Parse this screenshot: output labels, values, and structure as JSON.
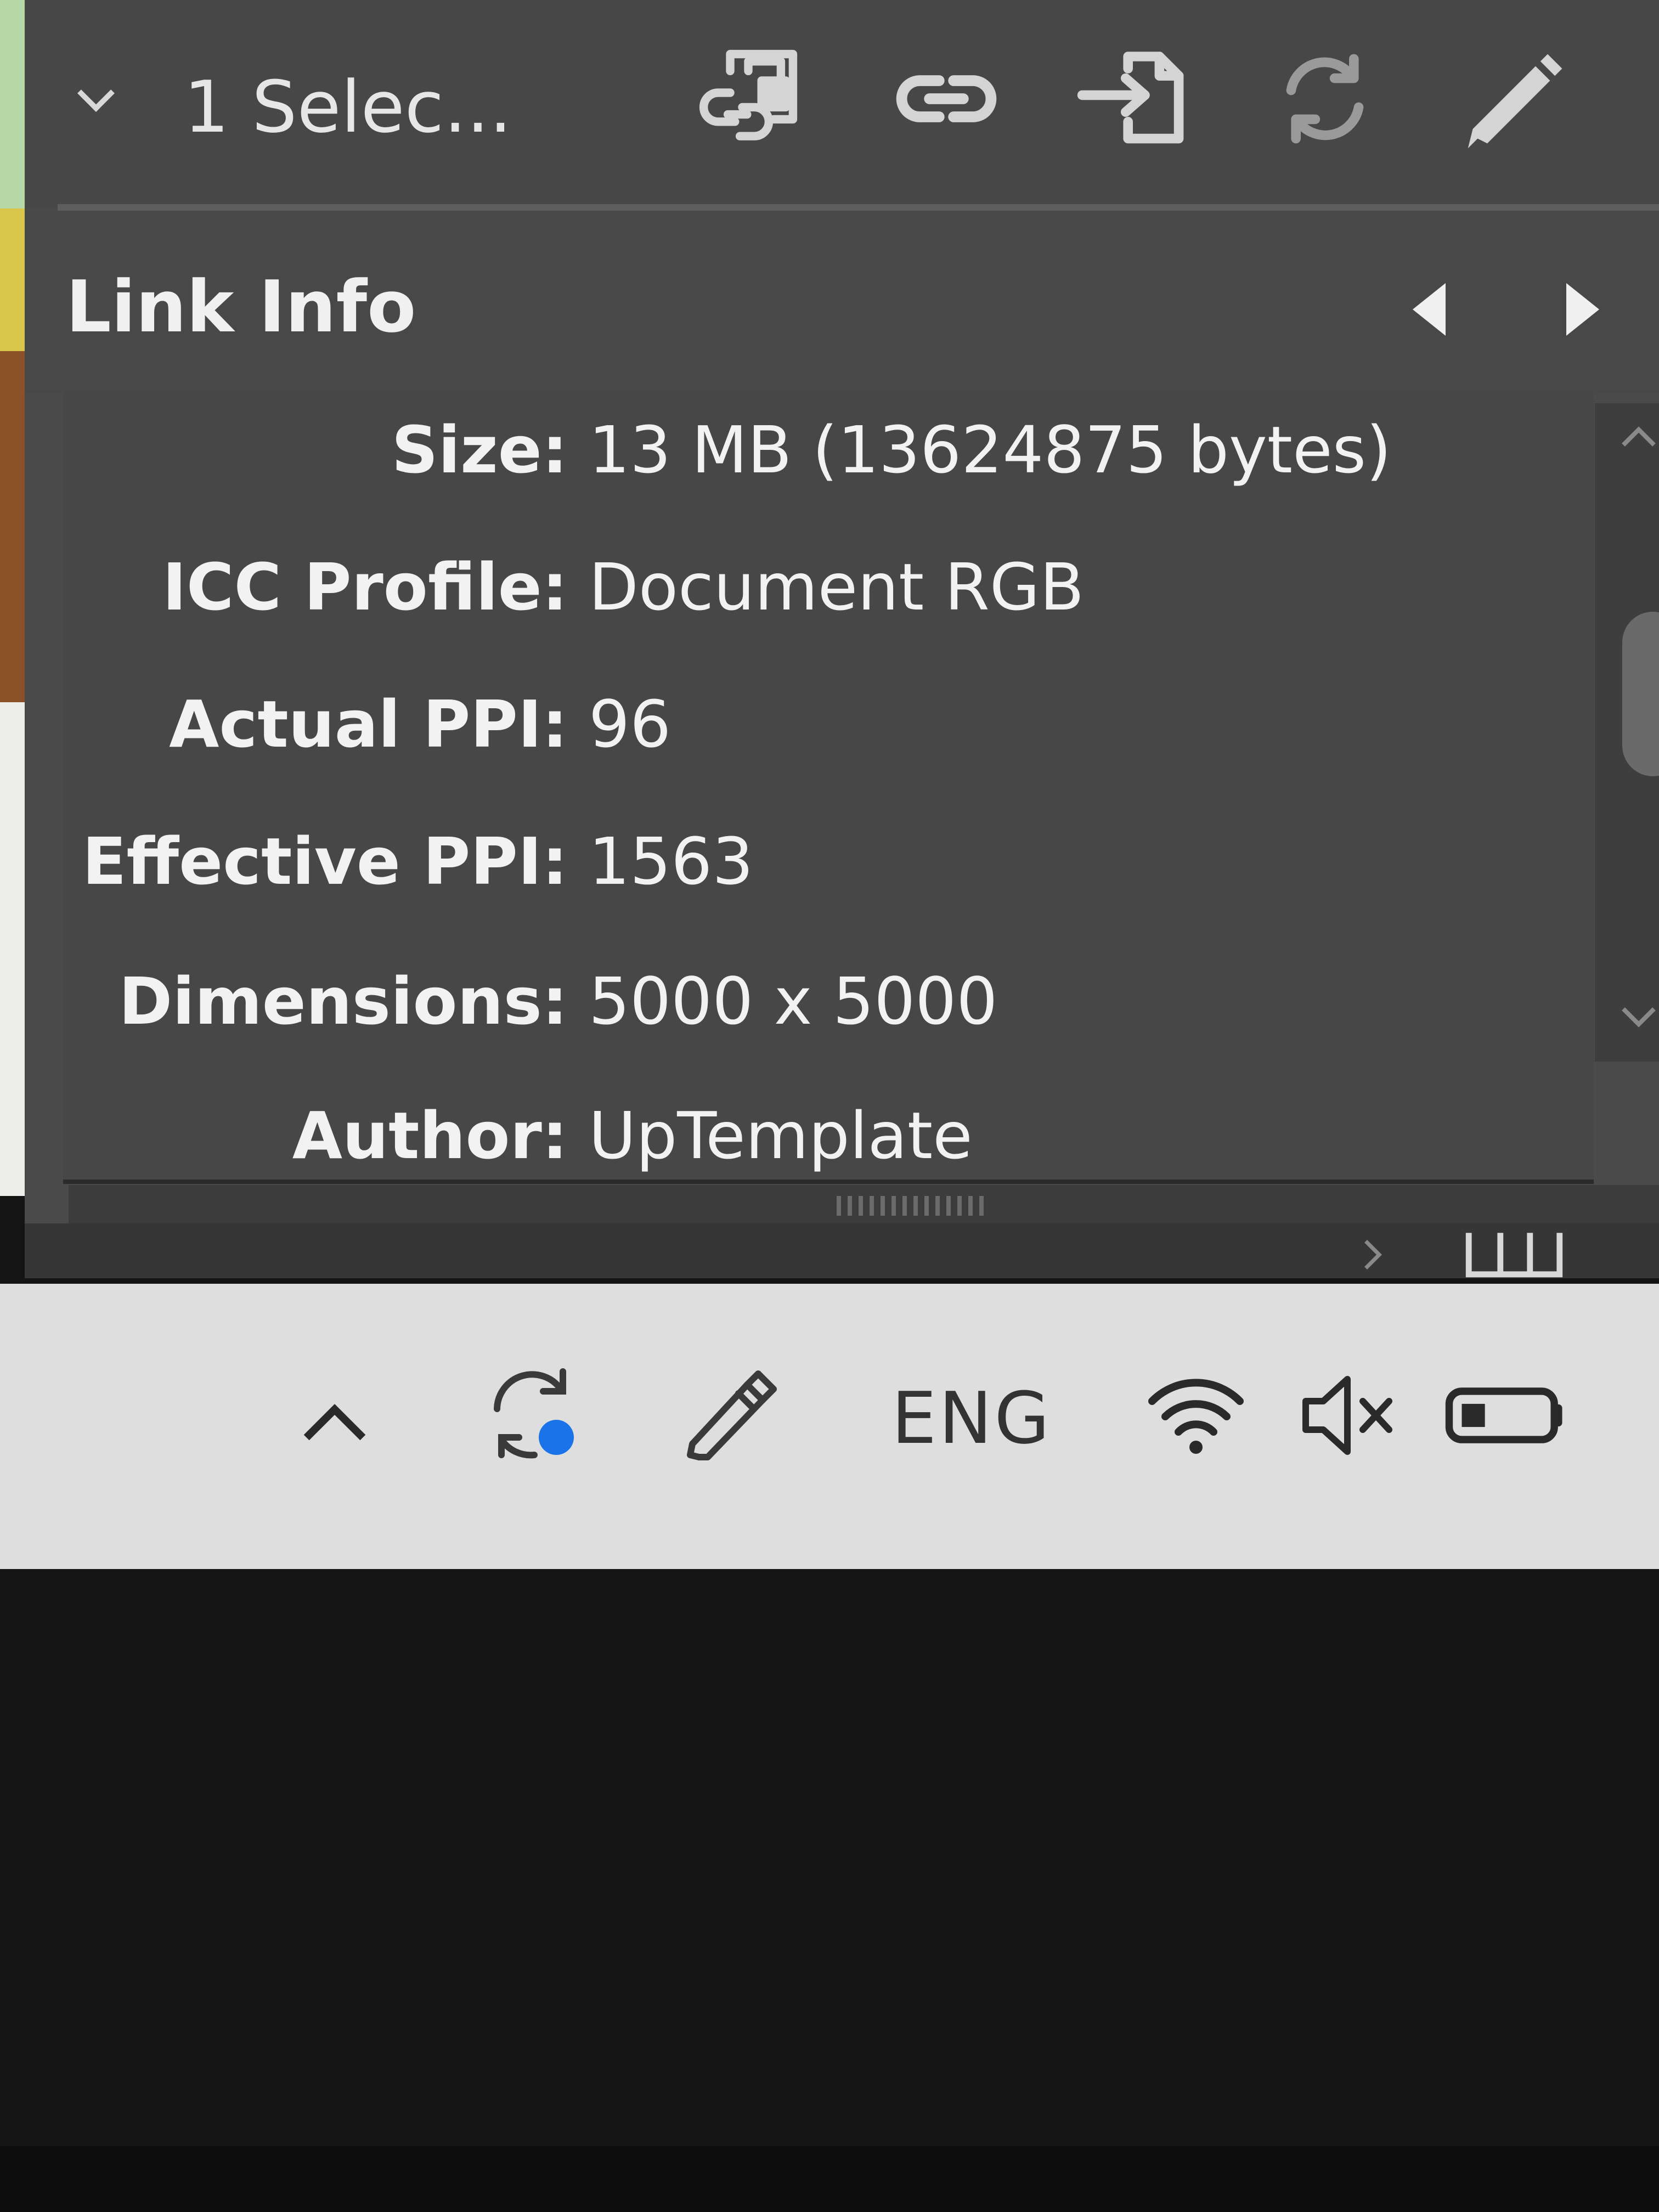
{
  "toolbar": {
    "selection_label": "1 Selec...",
    "icons": [
      "relink-from-library-icon",
      "relink-icon",
      "go-to-link-icon",
      "update-link-icon",
      "edit-original-icon"
    ]
  },
  "link_info": {
    "title": "Link Info",
    "rows": [
      {
        "key": "Size:",
        "value": "13 MB (13624875 bytes)"
      },
      {
        "key": "ICC Profile:",
        "value": "Document RGB"
      },
      {
        "key": "Actual PPI:",
        "value": "96"
      },
      {
        "key": "Effective PPI:",
        "value": "1563"
      },
      {
        "key": "Dimensions:",
        "value": "5000 x 5000"
      },
      {
        "key": "Author:",
        "value": "UpTemplate"
      }
    ]
  },
  "taskbar": {
    "language": "ENG",
    "icons": [
      "show-hidden-icons-chevron",
      "sync-icon",
      "pen-icon",
      "wifi-icon",
      "volume-muted-icon",
      "battery-icon"
    ]
  },
  "colors": {
    "panel_bg": "#4a4a4a",
    "panel_text": "#f2f2f2",
    "taskbar_bg": "#dedede",
    "accent_blue": "#1a73e8"
  }
}
